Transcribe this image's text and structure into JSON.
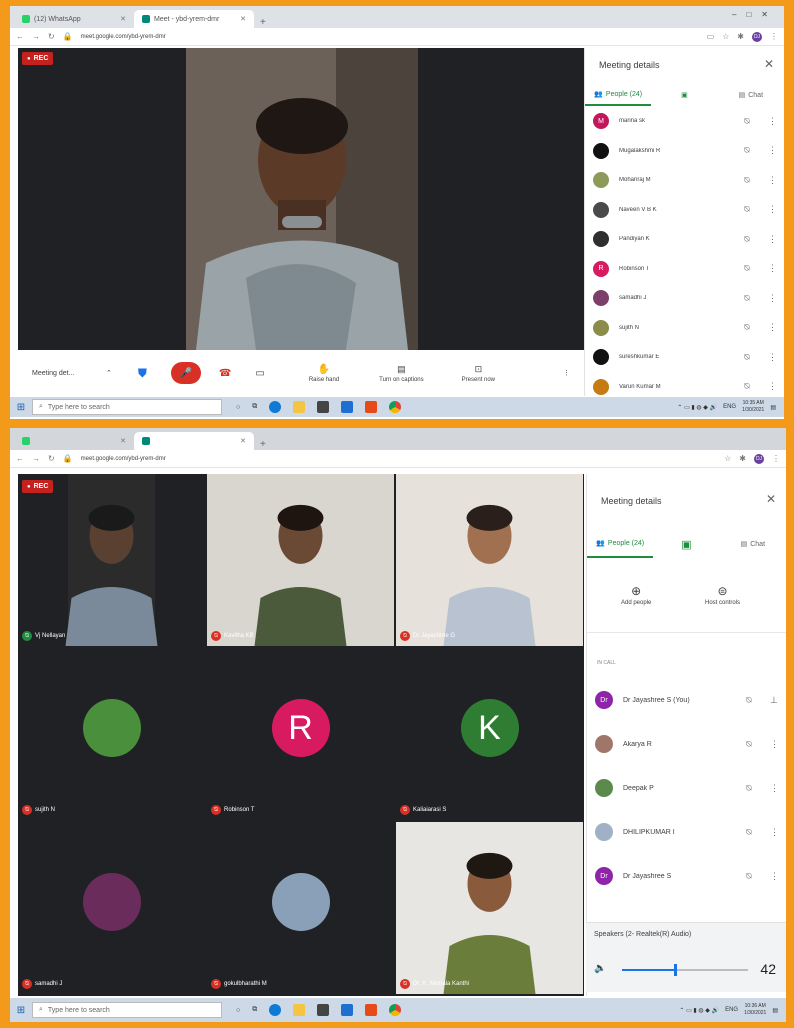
{
  "colors": {
    "frame": "#f39a1a",
    "meet_dark": "#202124",
    "tile": "#3c4043",
    "green_accent": "#1e8e3e",
    "rec_red": "#c5221f",
    "end_call_red": "#d93025"
  },
  "top": {
    "tabs": [
      {
        "label": "(12) WhatsApp",
        "active": false
      },
      {
        "label": "Meet - ybd-yrem-dmr",
        "active": true
      }
    ],
    "url": "meet.google.com/ybd-yrem-dmr",
    "rec": "REC",
    "panel": {
      "title": "Meeting details",
      "tab_people": "People (24)",
      "tab_chat": "Chat",
      "people": [
        {
          "name": "marina sk",
          "initial": "M",
          "color": "#c2185b"
        },
        {
          "name": "Mugalakshmi R",
          "initial": "",
          "color": "#111111"
        },
        {
          "name": "Mohanraj M",
          "initial": "",
          "color": "#8d9a5a"
        },
        {
          "name": "Naveen V B K",
          "initial": "",
          "color": "#4a4a4a"
        },
        {
          "name": "Pandiyan K",
          "initial": "",
          "color": "#2f2f2f"
        },
        {
          "name": "Robinson T",
          "initial": "R",
          "color": "#d81b60"
        },
        {
          "name": "samadhi J",
          "initial": "",
          "color": "#7b3f6a"
        },
        {
          "name": "sujith N",
          "initial": "",
          "color": "#8b8b4a"
        },
        {
          "name": "sureshkumar E",
          "initial": "",
          "color": "#111111"
        },
        {
          "name": "Varun Kumar M",
          "initial": "",
          "color": "#c57a12"
        }
      ]
    },
    "controls": {
      "meeting_details": "Meeting det...",
      "raise_hand": "Raise hand",
      "captions": "Turn on captions",
      "present": "Present now"
    },
    "taskbar": {
      "search": "Type here to search",
      "lang": "ENG",
      "time": "10:35 AM",
      "date": "1/30/2021"
    }
  },
  "bottom": {
    "url": "meet.google.com/ybd-yrem-dmr",
    "rec": "REC",
    "tiles": [
      {
        "name": "Vj Nellayan",
        "kind": "video"
      },
      {
        "name": "Kavitha KB",
        "kind": "video"
      },
      {
        "name": "Dr Jayashree G",
        "kind": "video"
      },
      {
        "name": "sujith N",
        "kind": "avatar",
        "initial": "",
        "color": "#4a8f3c"
      },
      {
        "name": "Robinson T",
        "kind": "avatar",
        "initial": "R",
        "color": "#d81b60"
      },
      {
        "name": "Kaliaiarasi S",
        "kind": "avatar",
        "initial": "K",
        "color": "#2e7d32"
      },
      {
        "name": "samadhi J",
        "kind": "avatar",
        "initial": "",
        "color": "#6a2c5a"
      },
      {
        "name": "gokulbharathi M",
        "kind": "avatar",
        "initial": "",
        "color": "#8aa0b8"
      },
      {
        "name": "Dr. K. Nirmala Kanthi",
        "kind": "video"
      }
    ],
    "panel": {
      "title": "Meeting details",
      "tab_people": "People (24)",
      "tab_chat": "Chat",
      "add_people": "Add people",
      "host_controls": "Host controls",
      "section": "IN CALL",
      "people": [
        {
          "name": "Dr Jayashree S (You)",
          "initial": "Dr",
          "color": "#8e24aa"
        },
        {
          "name": "Akarya R",
          "initial": "",
          "color": "#a1766a"
        },
        {
          "name": "Deepak P",
          "initial": "",
          "color": "#5b8a4c"
        },
        {
          "name": "DHILIPKUMAR I",
          "initial": "",
          "color": "#9fb0c7"
        },
        {
          "name": "Dr Jayashree S",
          "initial": "Dr",
          "color": "#8e24aa"
        }
      ],
      "speakers_label": "Speakers (2- Realtek(R) Audio)",
      "volume": 42
    },
    "taskbar": {
      "search": "Type here to search",
      "lang": "ENG",
      "time": "10:36 AM",
      "date": "1/30/2021"
    }
  }
}
